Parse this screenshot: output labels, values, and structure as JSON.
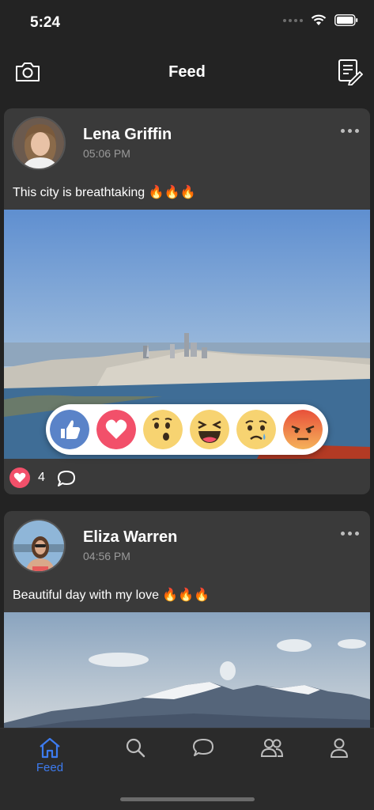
{
  "status": {
    "time": "5:24"
  },
  "nav": {
    "title": "Feed"
  },
  "posts": [
    {
      "author": "Lena Griffin",
      "time": "05:06 PM",
      "text": "This city is breathtaking 🔥🔥🔥",
      "reaction_count": "4"
    },
    {
      "author": "Eliza Warren",
      "time": "04:56 PM",
      "text": "Beautiful day with my love 🔥🔥🔥"
    }
  ],
  "reactions": [
    "like",
    "love",
    "wow",
    "haha",
    "sad",
    "angry"
  ],
  "tabs": [
    {
      "icon": "home-icon",
      "label": "Feed",
      "active": true
    },
    {
      "icon": "search-icon",
      "label": ""
    },
    {
      "icon": "chat-icon",
      "label": ""
    },
    {
      "icon": "friends-icon",
      "label": ""
    },
    {
      "icon": "profile-icon",
      "label": ""
    }
  ],
  "colors": {
    "accent": "#3d7bef",
    "card": "#3a3a3a",
    "background": "#232323",
    "love": "#f2506a"
  }
}
